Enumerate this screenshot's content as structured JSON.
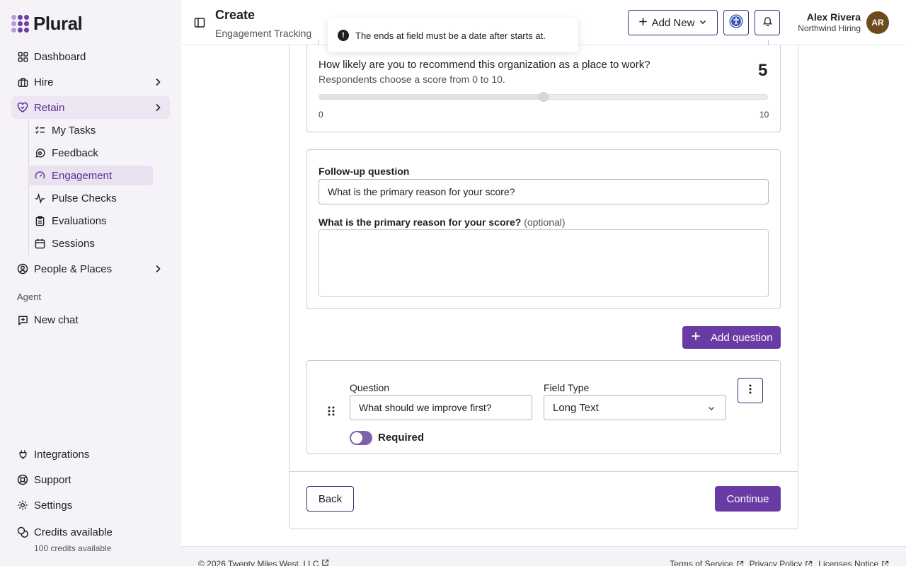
{
  "brand": {
    "name": "Plural"
  },
  "sidebar": {
    "items": [
      {
        "label": "Dashboard",
        "icon": "dashboard-icon"
      },
      {
        "label": "Hire",
        "icon": "briefcase-icon"
      },
      {
        "label": "Retain",
        "icon": "heart-handshake-icon"
      },
      {
        "label": "People & Places",
        "icon": "user-circle-icon"
      }
    ],
    "retain_sub": [
      {
        "label": "My Tasks",
        "icon": "list-check-icon"
      },
      {
        "label": "Feedback",
        "icon": "message-circle-icon"
      },
      {
        "label": "Engagement",
        "icon": "gauge-icon"
      },
      {
        "label": "Pulse Checks",
        "icon": "pulse-icon"
      },
      {
        "label": "Evaluations",
        "icon": "clipboard-icon"
      },
      {
        "label": "Sessions",
        "icon": "calendar-icon"
      }
    ],
    "agent_label": "Agent",
    "new_chat": "New chat",
    "bottom": [
      {
        "label": "Integrations",
        "icon": "plug-icon"
      },
      {
        "label": "Support",
        "icon": "lifebuoy-icon"
      },
      {
        "label": "Settings",
        "icon": "gear-icon"
      },
      {
        "label": "Credits available",
        "icon": "coins-icon"
      }
    ],
    "credits_detail": "100 credits available"
  },
  "header": {
    "title": "Create",
    "subtitle": "Engagement Tracking",
    "add_new": "Add New",
    "user_name": "Alex Rivera",
    "user_org": "Northwind Hiring",
    "avatar_initials": "AR"
  },
  "toast": {
    "message": "The ends at field must be a date after starts at."
  },
  "form": {
    "nps": {
      "question": "How likely are you to recommend this organization as a place to work?",
      "help": "Respondents choose a score from 0 to 10.",
      "value": "5",
      "min_label": "0",
      "max_label": "10",
      "fraction": 0.5
    },
    "followup": {
      "label": "Follow-up question",
      "value": "What is the primary reason for your score?",
      "preview_label": "What is the primary reason for your score?",
      "optional": "(optional)"
    },
    "add_question": "Add question",
    "new_question": {
      "question_label": "Question",
      "question_value": "What should we improve first?",
      "field_type_label": "Field Type",
      "field_type_value": "Long Text",
      "required_label": "Required"
    },
    "back": "Back",
    "continue": "Continue"
  },
  "footer": {
    "copyright": "© 2026 Twenty Miles West, LLC",
    "links": [
      "Terms of Service",
      "Privacy Policy",
      "Licenses Notice"
    ]
  },
  "colors": {
    "accent": "#6a3ba5",
    "sidebar_bg": "#f5f3f8"
  }
}
